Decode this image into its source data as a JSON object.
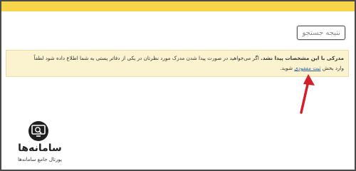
{
  "search": {
    "placeholder": "نتیجه جستجو"
  },
  "alert": {
    "bold_text": "مدرکی با این مشخصات پیدا نشد.",
    "text_line1": "اگر می‌خواهید در صورت پیدا شدن مدرک مورد نظرتان در یکی از دفاتر پستی به شما اطلاع داده شود لطفاً",
    "text_before_link": "وارد بخش",
    "link_label": "ثبت مفقودی",
    "text_after_link": "شوید."
  },
  "logo": {
    "name": "سامانه‌ها",
    "tagline": "پورتال جامع سامانه‌ها"
  },
  "colors": {
    "top_band": "#f6d54a",
    "alert_background": "#fbf3d0",
    "link": "#2d5f9a",
    "arrow": "#d21f2b"
  },
  "icons": [
    "search-monitor-icon",
    "arrow-up-icon"
  ]
}
